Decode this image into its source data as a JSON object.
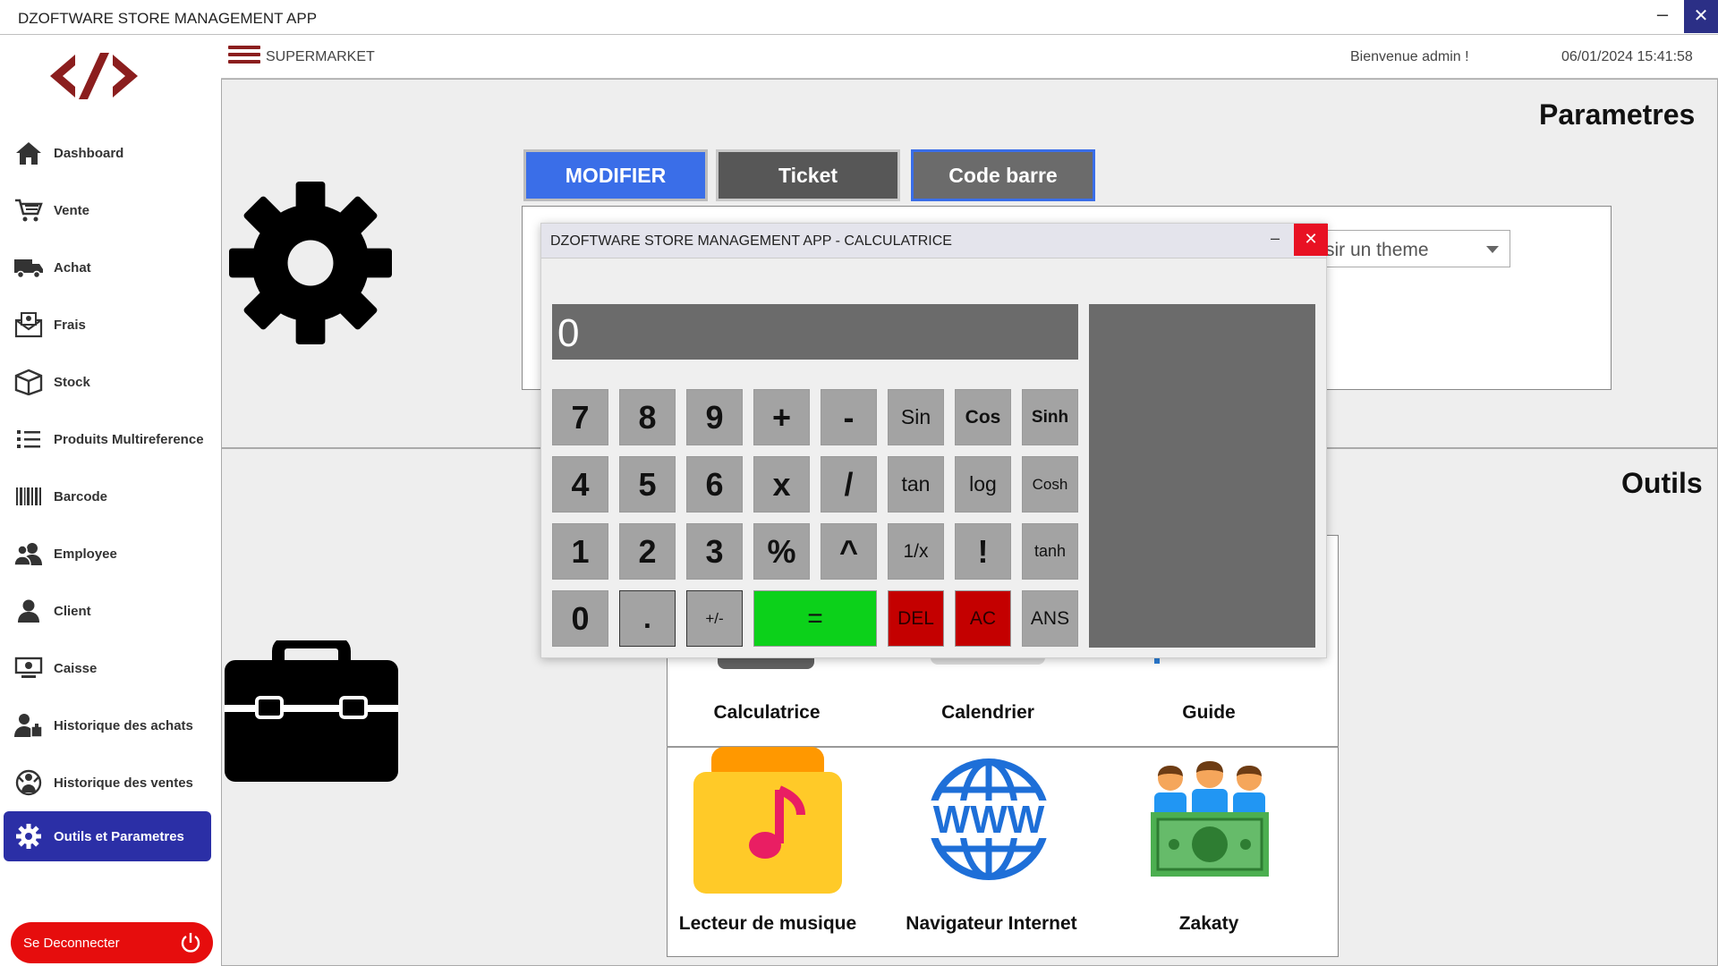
{
  "window": {
    "title": "DZOFTWARE STORE MANAGEMENT APP",
    "minimize": "–",
    "close": "✕"
  },
  "header": {
    "store_name": "SUPERMARKET",
    "welcome": "Bienvenue  admin !",
    "datetime": "06/01/2024 15:41:58"
  },
  "sidebar": {
    "items": [
      {
        "label": "Dashboard",
        "icon": "home-icon"
      },
      {
        "label": "Vente",
        "icon": "cart-icon"
      },
      {
        "label": "Achat",
        "icon": "truck-icon"
      },
      {
        "label": "Frais",
        "icon": "envelope-money-icon"
      },
      {
        "label": "Stock",
        "icon": "box-icon"
      },
      {
        "label": "Produits Multireference",
        "icon": "list-icon"
      },
      {
        "label": "Barcode",
        "icon": "barcode-icon"
      },
      {
        "label": "Employee",
        "icon": "users-icon"
      },
      {
        "label": "Client",
        "icon": "user-icon"
      },
      {
        "label": "Caisse",
        "icon": "cash-register-icon"
      },
      {
        "label": "Historique des achats",
        "icon": "user-history-icon"
      },
      {
        "label": "Historique des ventes",
        "icon": "person-sales-icon"
      },
      {
        "label": "Outils et Parametres",
        "icon": "gear-icon",
        "active": true
      }
    ],
    "logout": "Se Deconnecter"
  },
  "parametres": {
    "title": "Parametres",
    "tabs": [
      "MODIFIER",
      "Ticket",
      "Code barre"
    ],
    "theme_placeholder": "sir un theme"
  },
  "outils": {
    "title": "Outils",
    "tools": [
      "Calculatrice",
      "Calendrier",
      "Guide",
      "Lecteur de musique",
      "Navigateur Internet",
      "Zakaty"
    ]
  },
  "calculator": {
    "title": "DZOFTWARE STORE MANAGEMENT APP - CALCULATRICE",
    "minimize": "–",
    "close": "✕",
    "display": "0",
    "keys": [
      [
        "7",
        "8",
        "9",
        "+",
        "-",
        "Sin",
        "Cos",
        "Sinh"
      ],
      [
        "4",
        "5",
        "6",
        "x",
        "/",
        "tan",
        "log",
        "Cosh"
      ],
      [
        "1",
        "2",
        "3",
        "%",
        "^",
        "1/x",
        "!",
        "tanh"
      ],
      [
        "0",
        ".",
        "+/-",
        "=",
        "DEL",
        "AC",
        "ANS"
      ]
    ]
  },
  "colors": {
    "accent_blue": "#3a6ee8",
    "nav_active": "#2b2fa6",
    "logout_red": "#e60d0d",
    "brand_dark_red": "#8b1e1e",
    "equals_green": "#0cd11a"
  }
}
